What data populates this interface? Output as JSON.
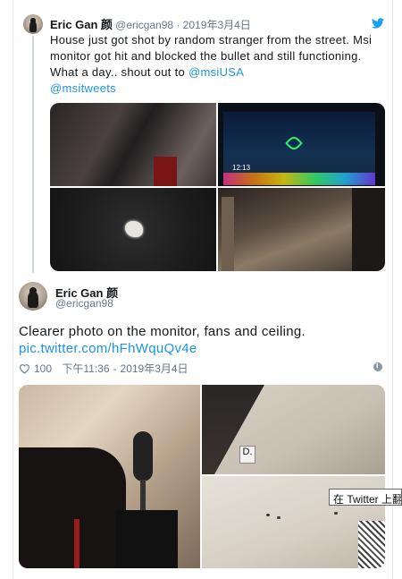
{
  "quoted_tweet": {
    "name": "Eric Gan",
    "name_glyph": "颜",
    "handle": "@ericgan98",
    "date": "2019年3月4日",
    "text": "House just got shot by random stranger from the street. Msi monitor got hit and blocked the bullet and still functioning. What a day.. shout out to ",
    "mention1": "@msiUSA",
    "mention2": "@msitweets",
    "photos": [
      "monitor-side-photo",
      "monitor-screen-photo",
      "bullet-fragment-photo",
      "street-door-photo"
    ]
  },
  "main_tweet": {
    "name": "Eric Gan",
    "name_glyph": "颜",
    "handle": "@ericgan98",
    "text": "Clearer photo on the monitor, fans and ceiling.",
    "link": "pic.twitter.com/hFhWquQv4e",
    "likes": "100",
    "time": "下午11:36",
    "date": "2019年3月4日",
    "photo_screen_time": "12:13",
    "photos": [
      "monitor-mic-photo",
      "ceiling-tag-photo",
      "ceiling-holes-photo"
    ]
  },
  "tooltip": {
    "text": "在 Twitter 上翻"
  },
  "colors": {
    "link": "#1b95e0",
    "muted": "#657786",
    "bird": "#1da1f2"
  }
}
